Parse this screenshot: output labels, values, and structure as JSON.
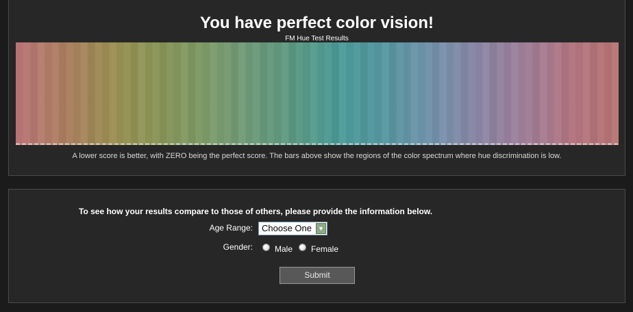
{
  "results": {
    "headline": "You have perfect color vision!",
    "subtitle": "FM Hue Test Results",
    "note": "A lower score is better, with ZERO being the perfect score. The bars above show the regions of the color spectrum where hue discrimination is low."
  },
  "spectrum": {
    "stops": [
      "#bb7478",
      "#ae7f62",
      "#9d8e53",
      "#8a9555",
      "#7f9b67",
      "#6f9a78",
      "#5c9a84",
      "#4a9a98",
      "#5898a2",
      "#7391ab",
      "#8c87a6",
      "#9f7d98",
      "#b47681",
      "#b77474"
    ],
    "error_bars": "none"
  },
  "form": {
    "prompt": "To see how your results compare to those of others, please provide the information below.",
    "age_label": "Age Range:",
    "age_value": "Choose One",
    "gender_label": "Gender:",
    "male_label": "Male",
    "female_label": "Female",
    "submit_label": "Submit"
  }
}
